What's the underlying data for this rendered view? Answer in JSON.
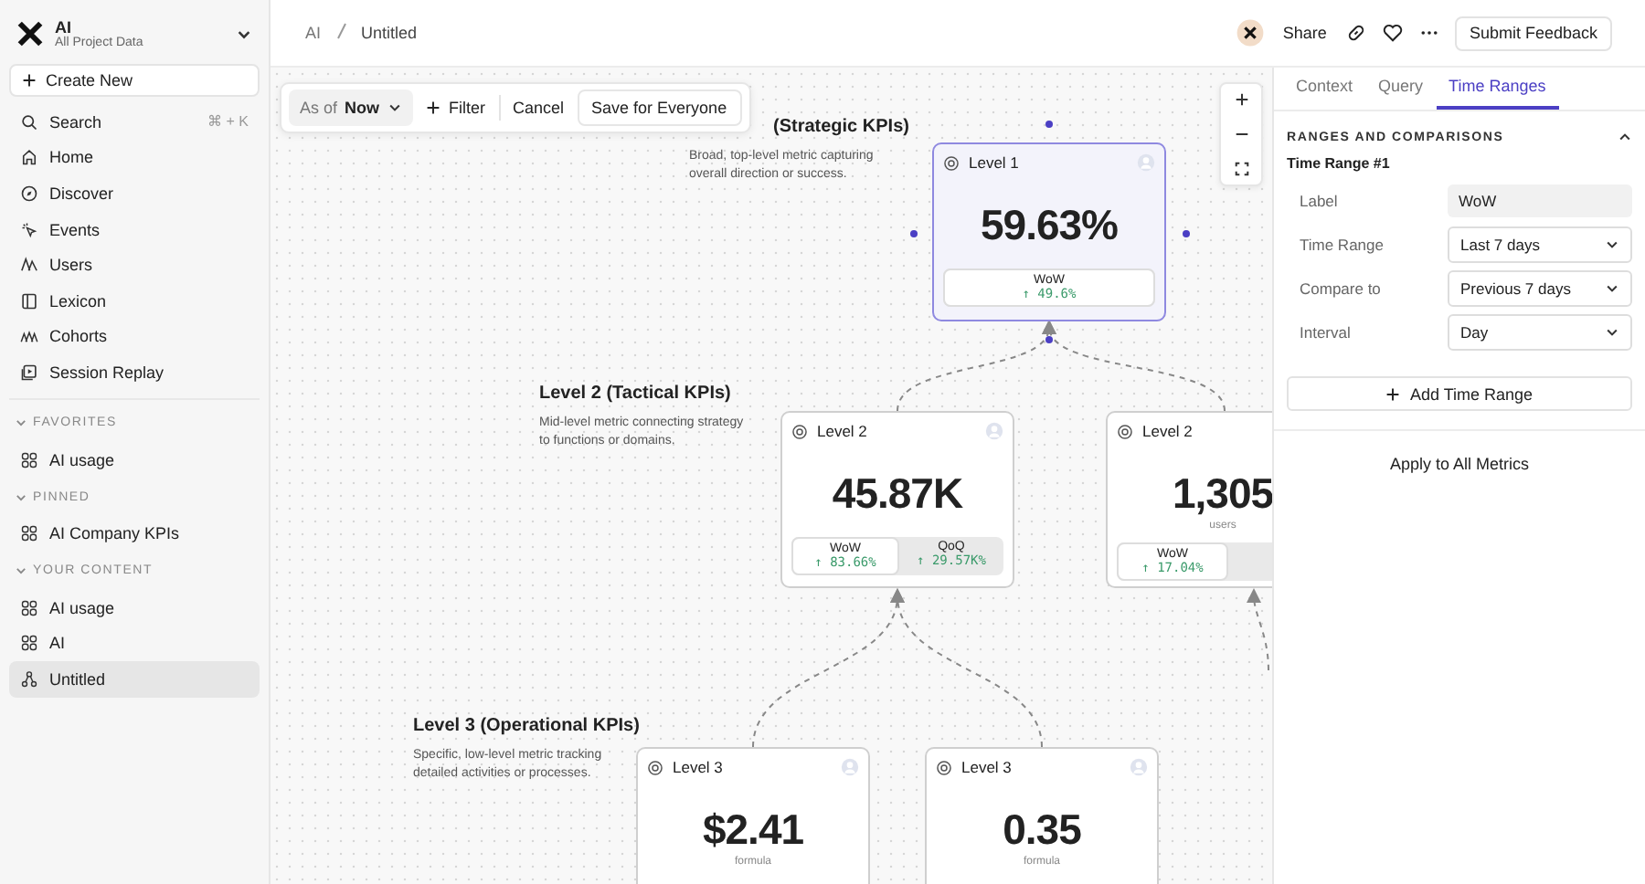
{
  "workspace": {
    "name": "AI",
    "subtitle": "All Project Data"
  },
  "sidebar": {
    "create_button": "Create New",
    "nav": [
      {
        "label": "Search",
        "shortcut": "⌘ + K",
        "selected": false
      },
      {
        "label": "Home",
        "selected": false
      },
      {
        "label": "Discover",
        "selected": false
      },
      {
        "label": "Events",
        "selected": false
      },
      {
        "label": "Users",
        "selected": false
      },
      {
        "label": "Lexicon",
        "selected": false
      },
      {
        "label": "Cohorts",
        "selected": false
      },
      {
        "label": "Session Replay",
        "selected": false
      }
    ],
    "sections": [
      {
        "title": "FAVORITES",
        "expanded": true,
        "items": [
          {
            "label": "AI usage",
            "kind": "board",
            "selected": false
          }
        ]
      },
      {
        "title": "PINNED",
        "expanded": true,
        "items": [
          {
            "label": "AI Company KPIs",
            "kind": "board",
            "selected": false
          }
        ]
      },
      {
        "title": "YOUR CONTENT",
        "expanded": true,
        "items": [
          {
            "label": "AI usage",
            "kind": "board",
            "selected": false
          },
          {
            "label": "AI",
            "kind": "board",
            "selected": false
          },
          {
            "label": "Untitled",
            "kind": "tree",
            "selected": true
          }
        ]
      }
    ]
  },
  "breadcrumb": [
    "AI",
    "Untitled"
  ],
  "header_actions": {
    "share": "Share",
    "feedback": "Submit Feedback"
  },
  "toolbar": {
    "as_of_label": "As of",
    "as_of_value": "Now",
    "filter": "Filter",
    "cancel": "Cancel",
    "save": "Save for Everyone"
  },
  "levels": [
    {
      "title": "(Strategic KPIs)",
      "description": "Broad, top-level metric capturing overall direction or success."
    },
    {
      "title": "Level 2 (Tactical KPIs)",
      "description": "Mid-level metric connecting strategy to functions or domains."
    },
    {
      "title": "Level 3 (Operational KPIs)",
      "description": "Specific, low-level metric tracking detailed activities or processes."
    }
  ],
  "nodes": [
    {
      "label": "Level 1",
      "value": "59.63%",
      "selected": true,
      "comparisons": [
        {
          "label": "WoW",
          "change": "↑ 49.6%",
          "selected": true
        }
      ]
    },
    {
      "label": "Level 2",
      "value": "45.87K",
      "selected": false,
      "comparisons": [
        {
          "label": "WoW",
          "change": "↑ 83.66%",
          "selected": true
        },
        {
          "label": "QoQ",
          "change": "↑ 29.57K%",
          "selected": false
        }
      ]
    },
    {
      "label": "Level 2",
      "value": "1,305",
      "unit": "users",
      "selected": false,
      "comparisons": [
        {
          "label": "WoW",
          "change": "↑ 17.04%",
          "selected": true
        }
      ]
    },
    {
      "label": "Level 3",
      "value": "$2.41",
      "unit": "formula",
      "selected": false
    },
    {
      "label": "Level 3",
      "value": "0.35",
      "unit": "formula",
      "selected": false
    }
  ],
  "panel": {
    "tabs": [
      {
        "label": "Context",
        "selected": false
      },
      {
        "label": "Query",
        "selected": false
      },
      {
        "label": "Time Ranges",
        "selected": true
      }
    ],
    "section_title": "RANGES AND COMPARISONS",
    "expanded": true,
    "range_title": "Time Range #1",
    "fields": [
      {
        "label": "Label",
        "kind": "input",
        "value": "WoW"
      },
      {
        "label": "Time Range",
        "kind": "select",
        "value": "Last 7 days"
      },
      {
        "label": "Compare to",
        "kind": "select",
        "value": "Previous 7 days"
      },
      {
        "label": "Interval",
        "kind": "select",
        "value": "Day"
      }
    ],
    "add_button": "Add Time Range",
    "apply_button": "Apply to All Metrics"
  }
}
